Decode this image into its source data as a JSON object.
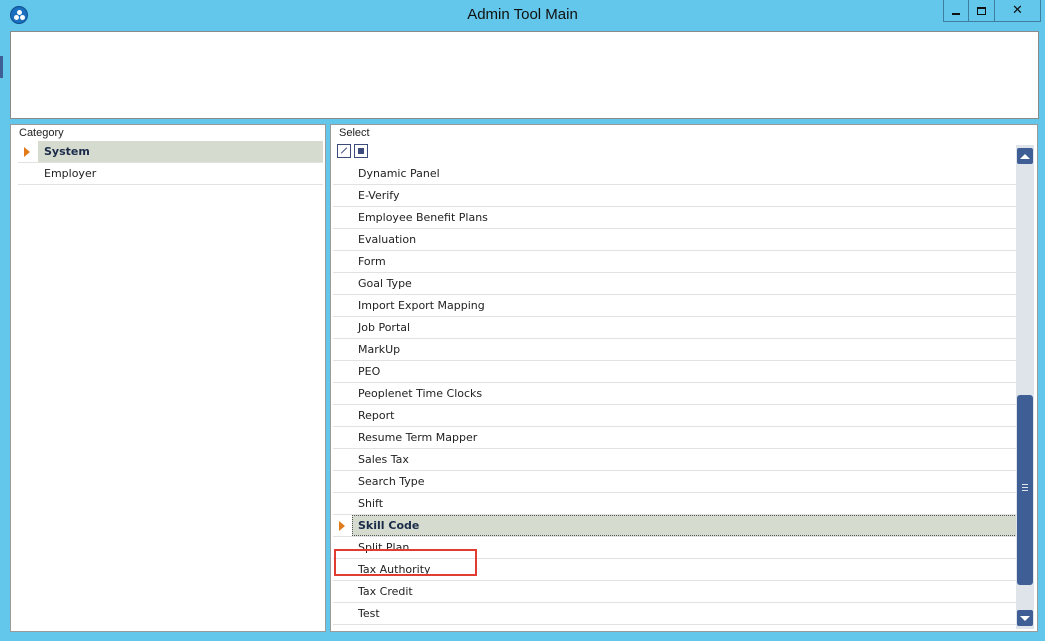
{
  "window": {
    "title": "Admin Tool Main"
  },
  "category": {
    "label": "Category",
    "items": [
      {
        "label": "System",
        "selected": true
      },
      {
        "label": "Employer",
        "selected": false
      }
    ]
  },
  "select": {
    "label": "Select",
    "toolbar": [
      "check-all-icon",
      "uncheck-all-icon"
    ],
    "items": [
      "Dynamic Panel",
      "E-Verify",
      "Employee Benefit Plans",
      "Evaluation",
      "Form",
      "Goal Type",
      "Import Export Mapping",
      "Job Portal",
      "MarkUp",
      "PEO",
      "Peoplenet Time Clocks",
      "Report",
      "Resume Term Mapper",
      "Sales Tax",
      "Search Type",
      "Shift",
      "Skill Code",
      "Split Plan",
      "Tax Authority",
      "Tax Credit",
      "Test"
    ],
    "selected_item": "Skill Code"
  },
  "colors": {
    "titlebar": "#62c7ea",
    "selection": "#d5dbce",
    "indicator": "#e07a1a",
    "scrollbar": "#3f5e95",
    "highlight": "#e03c31"
  }
}
